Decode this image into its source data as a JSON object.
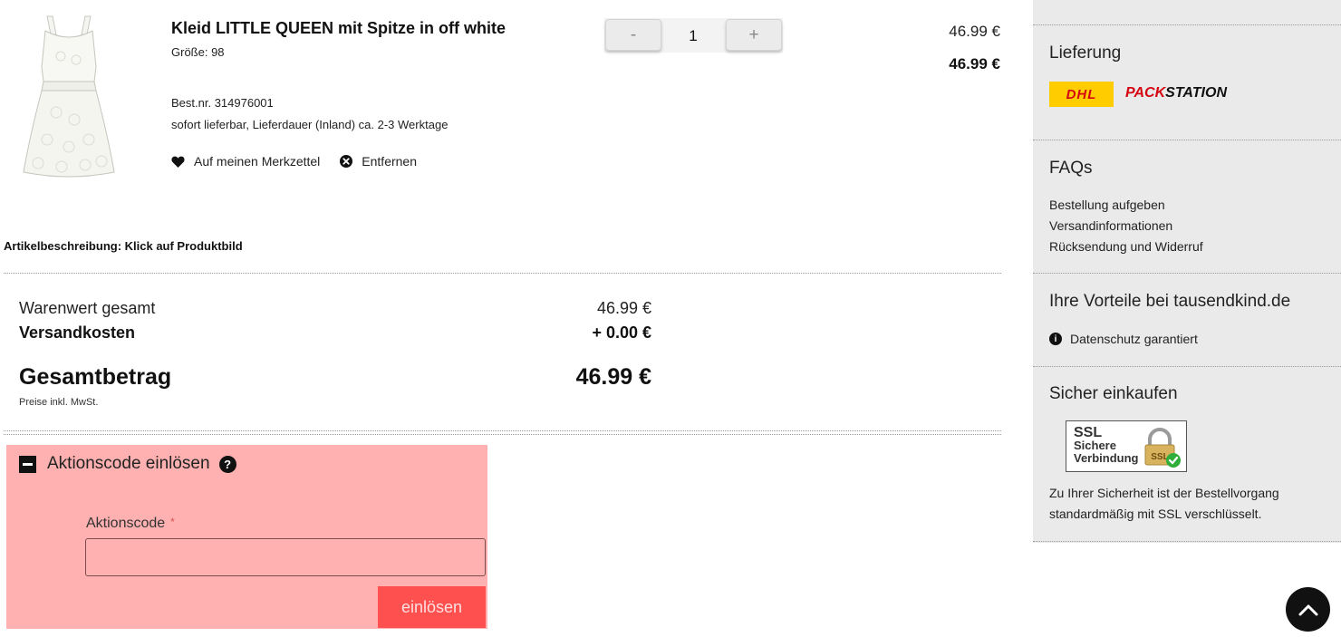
{
  "cart_item": {
    "title": "Kleid LITTLE QUEEN mit Spitze in off white",
    "size": "Größe: 98",
    "sku": "Best.nr. 314976001",
    "availability": "sofort lieferbar, Lieferdauer (Inland) ca. 2-3 Werktage",
    "wishlist_label": "Auf meinen Merkzettel",
    "remove_label": "Entfernen",
    "quantity": {
      "minus_label": "-",
      "value": "1",
      "plus_label": "+"
    },
    "unit_price": "46.99 €",
    "line_total": "46.99 €"
  },
  "description_hint": "Artikelbeschreibung: Klick auf Produktbild",
  "summary": {
    "goods_label": "Warenwert gesamt",
    "goods_value": "46.99 €",
    "shipping_label": "Versandkosten",
    "shipping_value": "+ 0.00 €",
    "total_label": "Gesamtbetrag",
    "total_value": "46.99 €",
    "vat_note": "Preise inkl. MwSt."
  },
  "promo": {
    "title": "Aktionscode einlösen",
    "help_symbol": "?",
    "field_label": "Aktionscode",
    "required_mark": "*",
    "value": "",
    "submit_label": "einlösen",
    "background_color": "#ffb1b1",
    "button_color": "#ff5050"
  },
  "sidebar": {
    "delivery": {
      "heading": "Lieferung",
      "dhl_logo_text": "DHL",
      "packstation_pack": "PACK",
      "packstation_station": "STATION"
    },
    "faqs": {
      "heading": "FAQs",
      "links": [
        "Bestellung aufgeben",
        "Versandinformationen",
        "Rücksendung und Widerruf"
      ]
    },
    "benefits": {
      "heading": "Ihre Vorteile bei tausendkind.de",
      "info_symbol": "i",
      "items": [
        "Datenschutz garantiert"
      ]
    },
    "secure": {
      "heading": "Sicher einkaufen",
      "badge_ssl": "SSL",
      "badge_line1": "Sichere",
      "badge_line2": "Verbindung",
      "badge_lock_text": "SSL",
      "text_line1": "Zu Ihrer Sicherheit ist der Bestellvorgang",
      "text_line2": "standardmäßig mit SSL verschlüsselt."
    }
  },
  "icons": {
    "wishlist": "heart-icon",
    "remove": "close-circle-icon",
    "promo_toggle": "minus-square-icon",
    "help": "question-circle-icon",
    "info": "info-circle-icon",
    "scroll_top": "chevron-up-icon"
  },
  "colors": {
    "dhl_yellow": "#ffcc00",
    "dhl_red": "#d40511",
    "sidebar_bg": "#eaeaea"
  }
}
